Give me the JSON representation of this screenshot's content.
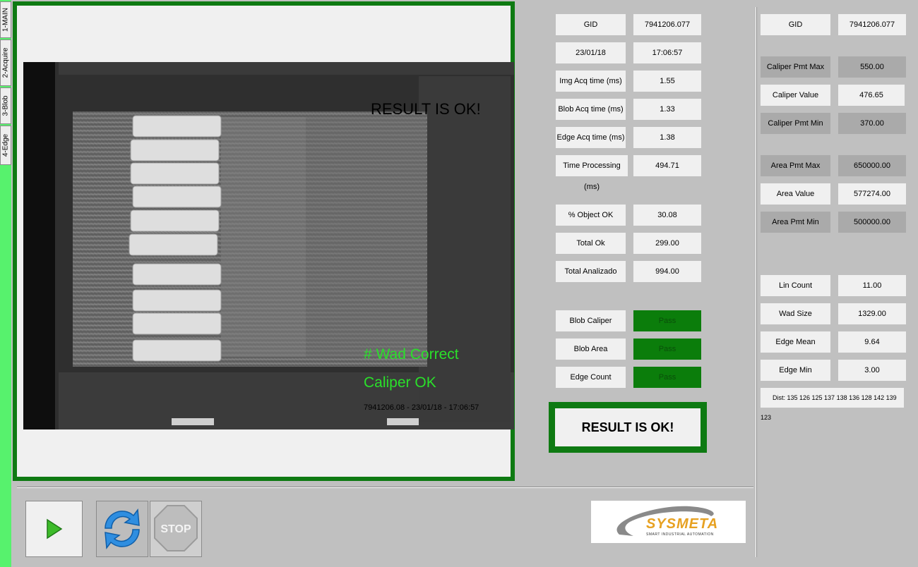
{
  "tabs": [
    "1-MAIN",
    "2-Acquire",
    "3-Blob",
    "4-Edge"
  ],
  "overlay": {
    "result": "RESULT IS OK!",
    "wad": "# Wad Correct",
    "caliper": "Caliper OK",
    "stamp": "7941206.08 - 23/01/18 - 17:06:57"
  },
  "middle": {
    "gid_label": "GID",
    "gid_value": "7941206.077",
    "date": "23/01/18",
    "time": "17:06:57",
    "img_acq_label": "Img Acq time (ms)",
    "img_acq_value": "1.55",
    "blob_acq_label": "Blob Acq time (ms)",
    "blob_acq_value": "1.33",
    "edge_acq_label": "Edge Acq time (ms)",
    "edge_acq_value": "1.38",
    "proc_label": "Time Processing (ms)",
    "proc_value": "494.71",
    "pct_ok_label": "% Object OK",
    "pct_ok_value": "30.08",
    "total_ok_label": "Total Ok",
    "total_ok_value": "299.00",
    "total_an_label": "Total Analizado",
    "total_an_value": "994.00",
    "blob_caliper_label": "Blob Caliper",
    "blob_caliper_value": "Pass",
    "blob_area_label": "Blob Area",
    "blob_area_value": "Pass",
    "edge_count_label": "Edge Count",
    "edge_count_value": "Pass",
    "result": "RESULT IS OK!"
  },
  "right": {
    "gid_label": "GID",
    "gid_value": "7941206.077",
    "cal_max_label": "Caliper Pmt Max",
    "cal_max_value": "550.00",
    "cal_val_label": "Caliper Value",
    "cal_val_value": "476.65",
    "cal_min_label": "Caliper Pmt Min",
    "cal_min_value": "370.00",
    "area_max_label": "Area Pmt Max",
    "area_max_value": "650000.00",
    "area_val_label": "Area Value",
    "area_val_value": "577274.00",
    "area_min_label": "Area Pmt Min",
    "area_min_value": "500000.00",
    "lin_label": "Lin Count",
    "lin_value": "11.00",
    "wad_label": "Wad Size",
    "wad_value": "1329.00",
    "edge_mean_label": "Edge Mean",
    "edge_mean_value": "9.64",
    "edge_min_label": "Edge Min",
    "edge_min_value": "3.00",
    "dist": "Dist:   135 126 125 137 138 136 128 142 139 123"
  },
  "buttons": {
    "stop": "STOP"
  },
  "logo": {
    "brand": "SYSMETA",
    "tagline": "SMART INDUSTRIAL AUTOMATION"
  },
  "colors": {
    "frame_green": "#0e7a12",
    "pass_green": "#0b7d0b",
    "tab_green": "#57f26d",
    "overlay_green": "#2ae02a"
  },
  "icons": [
    "play-icon",
    "refresh-icon",
    "stop-sign-icon",
    "sysmeta-logo"
  ]
}
